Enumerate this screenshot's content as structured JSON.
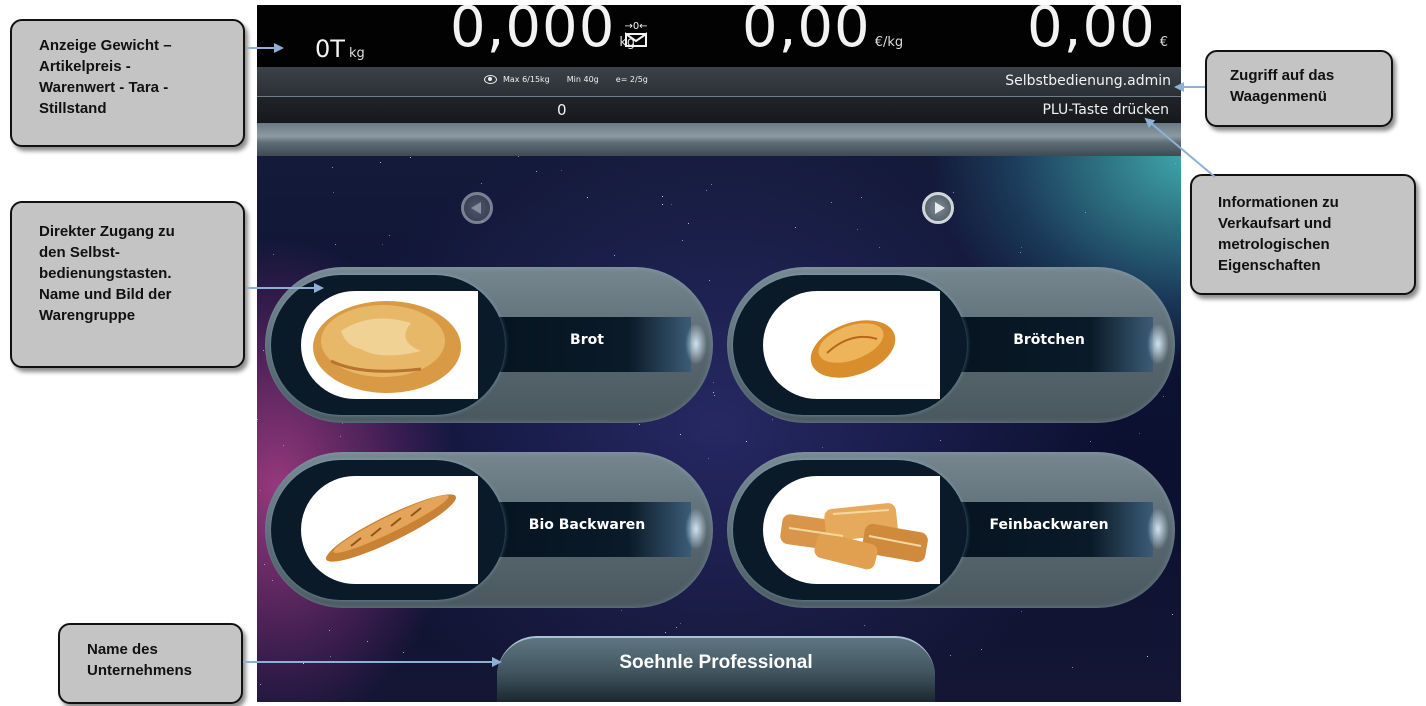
{
  "callouts": {
    "display": "Anzeige Gewicht –\nArtikelpreis -\nWarenwert - Tara -\nStillstand",
    "keys": "Direkter Zugang zu\nden Selbst-\nbedienungstasten.\nName und Bild der\nWarengruppe",
    "company": "Name des\nUnternehmens",
    "menu": "Zugriff auf das\nWaagenmenü",
    "info": "Informationen zu\nVerkaufsart und\nmetrologischen\nEigenschaften"
  },
  "display": {
    "tare": "0T",
    "tare_unit": "kg",
    "weight": "0,000",
    "weight_unit": "kg",
    "unit_price": "0,00",
    "unit_price_unit": "€/kg",
    "total": "0,00",
    "total_unit": "€",
    "stability_icon": "zero-stable-icon"
  },
  "info_bar": {
    "max": "Max 6/15kg",
    "min": "Min 40g",
    "e": "e= 2/5g",
    "user": "Selbstbedienung.admin"
  },
  "plu_bar": {
    "number": "0",
    "message": "PLU-Taste drücken"
  },
  "tiles": [
    {
      "label": "Brot",
      "image": "bread-loaf-image"
    },
    {
      "label": "Brötchen",
      "image": "bread-roll-image"
    },
    {
      "label": "Bio Backwaren",
      "image": "baguette-image"
    },
    {
      "label": "Feinbackwaren",
      "image": "pastries-image"
    }
  ],
  "company": {
    "name": "Soehnle Professional"
  },
  "colors": {
    "callout_bg": "#c4c4c4",
    "arrow": "#8eb0d6",
    "tile": "#5f707a",
    "display_bg": "#020203"
  }
}
